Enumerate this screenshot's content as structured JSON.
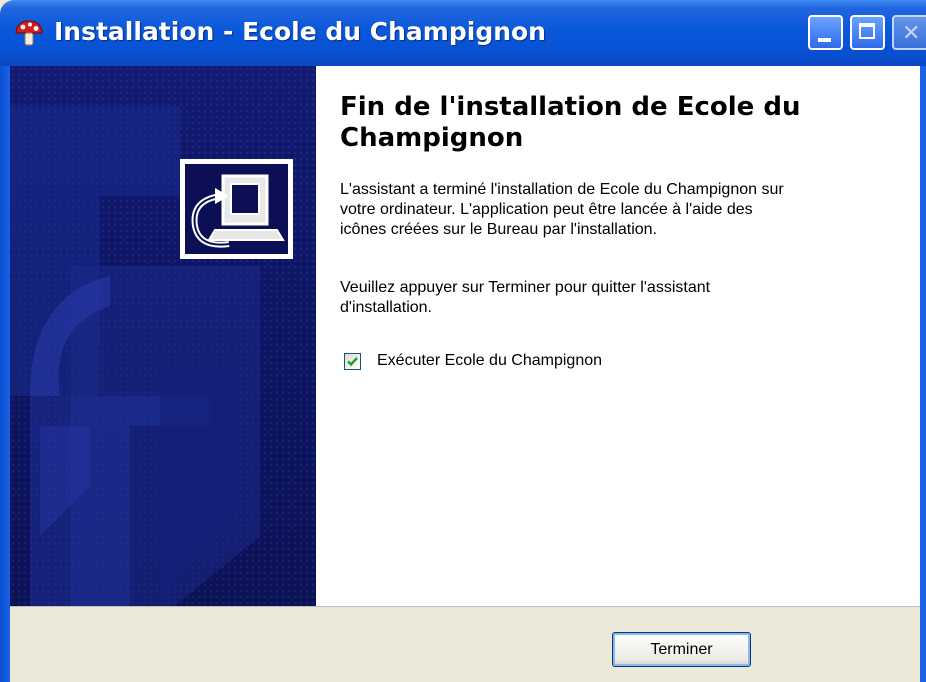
{
  "window": {
    "title": "Installation - Ecole du Champignon"
  },
  "content": {
    "heading": "Fin de l'installation de Ecole du Champignon",
    "paragraph1": "L'assistant a terminé l'installation de Ecole du Champignon sur\nvotre ordinateur. L'application peut être lancée à l'aide des\nicônes créées sur le Bureau par l'installation.",
    "paragraph2": "Veuillez appuyer sur Terminer pour quitter l'assistant\nd'installation.",
    "run_checkbox": {
      "label": "Exécuter Ecole du Champignon",
      "checked": true
    }
  },
  "footer": {
    "finish_label": "Terminer"
  },
  "icons": {
    "app": "mushroom-icon",
    "wizard": "computer-install-icon",
    "check": "check-icon"
  },
  "colors": {
    "titlebar": "#0a58da",
    "banner": "#0d1462",
    "checkmark": "#21a121"
  }
}
